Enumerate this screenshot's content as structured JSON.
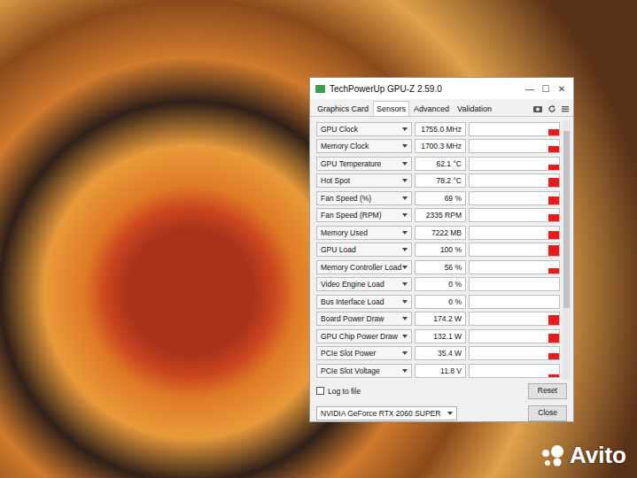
{
  "window": {
    "title": "TechPowerUp GPU-Z 2.59.0",
    "controls": [
      "—",
      "☐",
      "✕"
    ]
  },
  "tabs": [
    {
      "label": "Graphics Card",
      "selected": false
    },
    {
      "label": "Sensors",
      "selected": true
    },
    {
      "label": "Advanced",
      "selected": false
    },
    {
      "label": "Validation",
      "selected": false
    }
  ],
  "sensors": [
    {
      "label": "GPU Clock",
      "value": "1755.0 MHz",
      "level": 0.45
    },
    {
      "label": "Memory Clock",
      "value": "1700.3 MHz",
      "level": 0.5
    },
    {
      "label": "GPU Temperature",
      "value": "62.1 °C",
      "level": 0.4
    },
    {
      "label": "Hot Spot",
      "value": "78.2 °C",
      "level": 0.7
    },
    {
      "label": "Fan Speed (%)",
      "value": "69 %",
      "level": 0.6
    },
    {
      "label": "Fan Speed (RPM)",
      "value": "2335 RPM",
      "level": 0.6
    },
    {
      "label": "Memory Used",
      "value": "7222 MB",
      "level": 0.65
    },
    {
      "label": "GPU Load",
      "value": "100 %",
      "level": 0.85
    },
    {
      "label": "Memory Controller Load",
      "value": "56 %",
      "level": 0.4
    },
    {
      "label": "Video Engine Load",
      "value": "0 %",
      "level": 0
    },
    {
      "label": "Bus Interface Load",
      "value": "0 %",
      "level": 0
    },
    {
      "label": "Board Power Draw",
      "value": "174.2 W",
      "level": 0.8
    },
    {
      "label": "GPU Chip Power Draw",
      "value": "132.1 W",
      "level": 0.7
    },
    {
      "label": "PCIe Slot Power",
      "value": "35.4 W",
      "level": 0.5
    },
    {
      "label": "PCIe Slot Voltage",
      "value": "11.8 V",
      "level": 0.2
    }
  ],
  "log_to_file": {
    "label": "Log to file",
    "checked": false
  },
  "reset_button": "Reset",
  "gpu_select": "NVIDIA GeForce RTX 2060 SUPER",
  "close_button": "Close",
  "watermark": "Avito"
}
